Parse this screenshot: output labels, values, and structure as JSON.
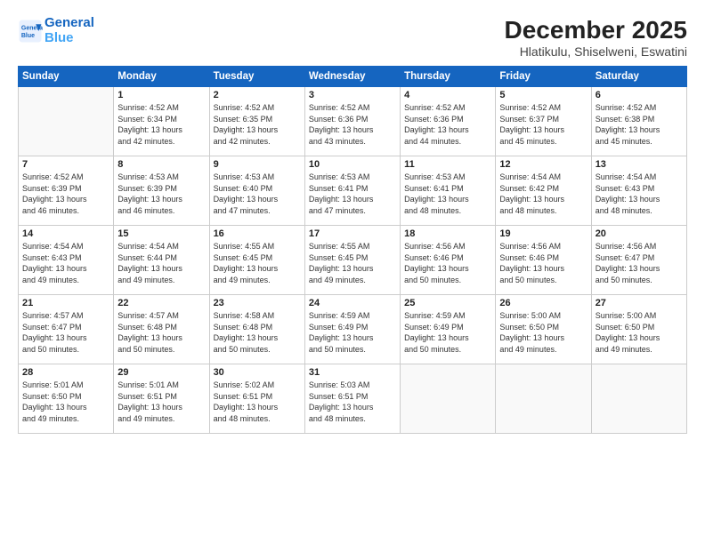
{
  "header": {
    "logo_line1": "General",
    "logo_line2": "Blue",
    "month_title": "December 2025",
    "subtitle": "Hlatikulu, Shiselweni, Eswatini"
  },
  "weekdays": [
    "Sunday",
    "Monday",
    "Tuesday",
    "Wednesday",
    "Thursday",
    "Friday",
    "Saturday"
  ],
  "weeks": [
    [
      {
        "day": "",
        "text": ""
      },
      {
        "day": "1",
        "text": "Sunrise: 4:52 AM\nSunset: 6:34 PM\nDaylight: 13 hours\nand 42 minutes."
      },
      {
        "day": "2",
        "text": "Sunrise: 4:52 AM\nSunset: 6:35 PM\nDaylight: 13 hours\nand 42 minutes."
      },
      {
        "day": "3",
        "text": "Sunrise: 4:52 AM\nSunset: 6:36 PM\nDaylight: 13 hours\nand 43 minutes."
      },
      {
        "day": "4",
        "text": "Sunrise: 4:52 AM\nSunset: 6:36 PM\nDaylight: 13 hours\nand 44 minutes."
      },
      {
        "day": "5",
        "text": "Sunrise: 4:52 AM\nSunset: 6:37 PM\nDaylight: 13 hours\nand 45 minutes."
      },
      {
        "day": "6",
        "text": "Sunrise: 4:52 AM\nSunset: 6:38 PM\nDaylight: 13 hours\nand 45 minutes."
      }
    ],
    [
      {
        "day": "7",
        "text": "Sunrise: 4:52 AM\nSunset: 6:39 PM\nDaylight: 13 hours\nand 46 minutes."
      },
      {
        "day": "8",
        "text": "Sunrise: 4:53 AM\nSunset: 6:39 PM\nDaylight: 13 hours\nand 46 minutes."
      },
      {
        "day": "9",
        "text": "Sunrise: 4:53 AM\nSunset: 6:40 PM\nDaylight: 13 hours\nand 47 minutes."
      },
      {
        "day": "10",
        "text": "Sunrise: 4:53 AM\nSunset: 6:41 PM\nDaylight: 13 hours\nand 47 minutes."
      },
      {
        "day": "11",
        "text": "Sunrise: 4:53 AM\nSunset: 6:41 PM\nDaylight: 13 hours\nand 48 minutes."
      },
      {
        "day": "12",
        "text": "Sunrise: 4:54 AM\nSunset: 6:42 PM\nDaylight: 13 hours\nand 48 minutes."
      },
      {
        "day": "13",
        "text": "Sunrise: 4:54 AM\nSunset: 6:43 PM\nDaylight: 13 hours\nand 48 minutes."
      }
    ],
    [
      {
        "day": "14",
        "text": "Sunrise: 4:54 AM\nSunset: 6:43 PM\nDaylight: 13 hours\nand 49 minutes."
      },
      {
        "day": "15",
        "text": "Sunrise: 4:54 AM\nSunset: 6:44 PM\nDaylight: 13 hours\nand 49 minutes."
      },
      {
        "day": "16",
        "text": "Sunrise: 4:55 AM\nSunset: 6:45 PM\nDaylight: 13 hours\nand 49 minutes."
      },
      {
        "day": "17",
        "text": "Sunrise: 4:55 AM\nSunset: 6:45 PM\nDaylight: 13 hours\nand 49 minutes."
      },
      {
        "day": "18",
        "text": "Sunrise: 4:56 AM\nSunset: 6:46 PM\nDaylight: 13 hours\nand 50 minutes."
      },
      {
        "day": "19",
        "text": "Sunrise: 4:56 AM\nSunset: 6:46 PM\nDaylight: 13 hours\nand 50 minutes."
      },
      {
        "day": "20",
        "text": "Sunrise: 4:56 AM\nSunset: 6:47 PM\nDaylight: 13 hours\nand 50 minutes."
      }
    ],
    [
      {
        "day": "21",
        "text": "Sunrise: 4:57 AM\nSunset: 6:47 PM\nDaylight: 13 hours\nand 50 minutes."
      },
      {
        "day": "22",
        "text": "Sunrise: 4:57 AM\nSunset: 6:48 PM\nDaylight: 13 hours\nand 50 minutes."
      },
      {
        "day": "23",
        "text": "Sunrise: 4:58 AM\nSunset: 6:48 PM\nDaylight: 13 hours\nand 50 minutes."
      },
      {
        "day": "24",
        "text": "Sunrise: 4:59 AM\nSunset: 6:49 PM\nDaylight: 13 hours\nand 50 minutes."
      },
      {
        "day": "25",
        "text": "Sunrise: 4:59 AM\nSunset: 6:49 PM\nDaylight: 13 hours\nand 50 minutes."
      },
      {
        "day": "26",
        "text": "Sunrise: 5:00 AM\nSunset: 6:50 PM\nDaylight: 13 hours\nand 49 minutes."
      },
      {
        "day": "27",
        "text": "Sunrise: 5:00 AM\nSunset: 6:50 PM\nDaylight: 13 hours\nand 49 minutes."
      }
    ],
    [
      {
        "day": "28",
        "text": "Sunrise: 5:01 AM\nSunset: 6:50 PM\nDaylight: 13 hours\nand 49 minutes."
      },
      {
        "day": "29",
        "text": "Sunrise: 5:01 AM\nSunset: 6:51 PM\nDaylight: 13 hours\nand 49 minutes."
      },
      {
        "day": "30",
        "text": "Sunrise: 5:02 AM\nSunset: 6:51 PM\nDaylight: 13 hours\nand 48 minutes."
      },
      {
        "day": "31",
        "text": "Sunrise: 5:03 AM\nSunset: 6:51 PM\nDaylight: 13 hours\nand 48 minutes."
      },
      {
        "day": "",
        "text": ""
      },
      {
        "day": "",
        "text": ""
      },
      {
        "day": "",
        "text": ""
      }
    ]
  ]
}
